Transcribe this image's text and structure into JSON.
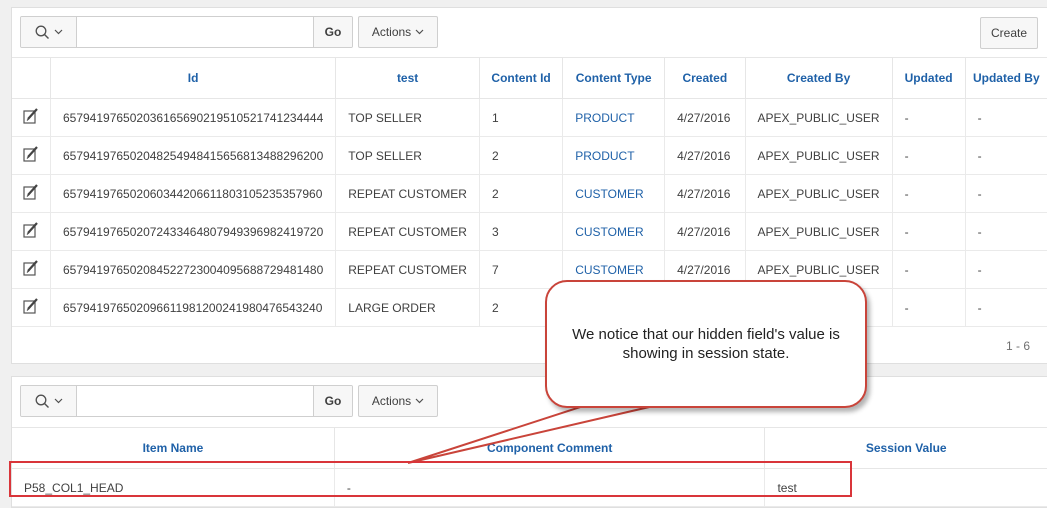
{
  "region1": {
    "search_placeholder": "",
    "go_label": "Go",
    "actions_label": "Actions",
    "create_label": "Create",
    "columns": [
      "Id",
      "test",
      "Content Id",
      "Content Type",
      "Created",
      "Created By",
      "Updated",
      "Updated By"
    ],
    "rows": [
      {
        "id": "657941976502036165690219510521741234444",
        "test": "TOP SELLER",
        "content_id": "1",
        "content_type": "PRODUCT",
        "created": "4/27/2016",
        "created_by": "APEX_PUBLIC_USER",
        "updated": "-",
        "updated_by": "-"
      },
      {
        "id": "657941976502048254948415656813488296200",
        "test": "TOP SELLER",
        "content_id": "2",
        "content_type": "PRODUCT",
        "created": "4/27/2016",
        "created_by": "APEX_PUBLIC_USER",
        "updated": "-",
        "updated_by": "-"
      },
      {
        "id": "657941976502060344206611803105235357960",
        "test": "REPEAT CUSTOMER",
        "content_id": "2",
        "content_type": "CUSTOMER",
        "created": "4/27/2016",
        "created_by": "APEX_PUBLIC_USER",
        "updated": "-",
        "updated_by": "-"
      },
      {
        "id": "657941976502072433464807949396982419720",
        "test": "REPEAT CUSTOMER",
        "content_id": "3",
        "content_type": "CUSTOMER",
        "created": "4/27/2016",
        "created_by": "APEX_PUBLIC_USER",
        "updated": "-",
        "updated_by": "-"
      },
      {
        "id": "657941976502084522723004095688729481480",
        "test": "REPEAT CUSTOMER",
        "content_id": "7",
        "content_type": "CUSTOMER",
        "created": "4/27/2016",
        "created_by": "APEX_PUBLIC_USER",
        "updated": "-",
        "updated_by": "-"
      },
      {
        "id": "657941976502096611981200241980476543240",
        "test": "LARGE ORDER",
        "content_id": "2",
        "content_type": "",
        "created": "",
        "created_by": "",
        "updated": "-",
        "updated_by": "-"
      }
    ],
    "pagination": "1 - 6"
  },
  "region2": {
    "go_label": "Go",
    "actions_label": "Actions",
    "columns": [
      "Item Name",
      "Component Comment",
      "Session Value"
    ],
    "rows": [
      {
        "item_name": "P58_COL1_HEAD",
        "component_comment": "-",
        "session_value": "test"
      }
    ]
  },
  "callout": {
    "text": "We notice that our hidden field's value is showing in session state."
  },
  "colors": {
    "link": "#1f61a8",
    "highlight": "#d9353a"
  },
  "icons": {
    "edit": "edit-pencil-icon",
    "search": "search-icon"
  }
}
